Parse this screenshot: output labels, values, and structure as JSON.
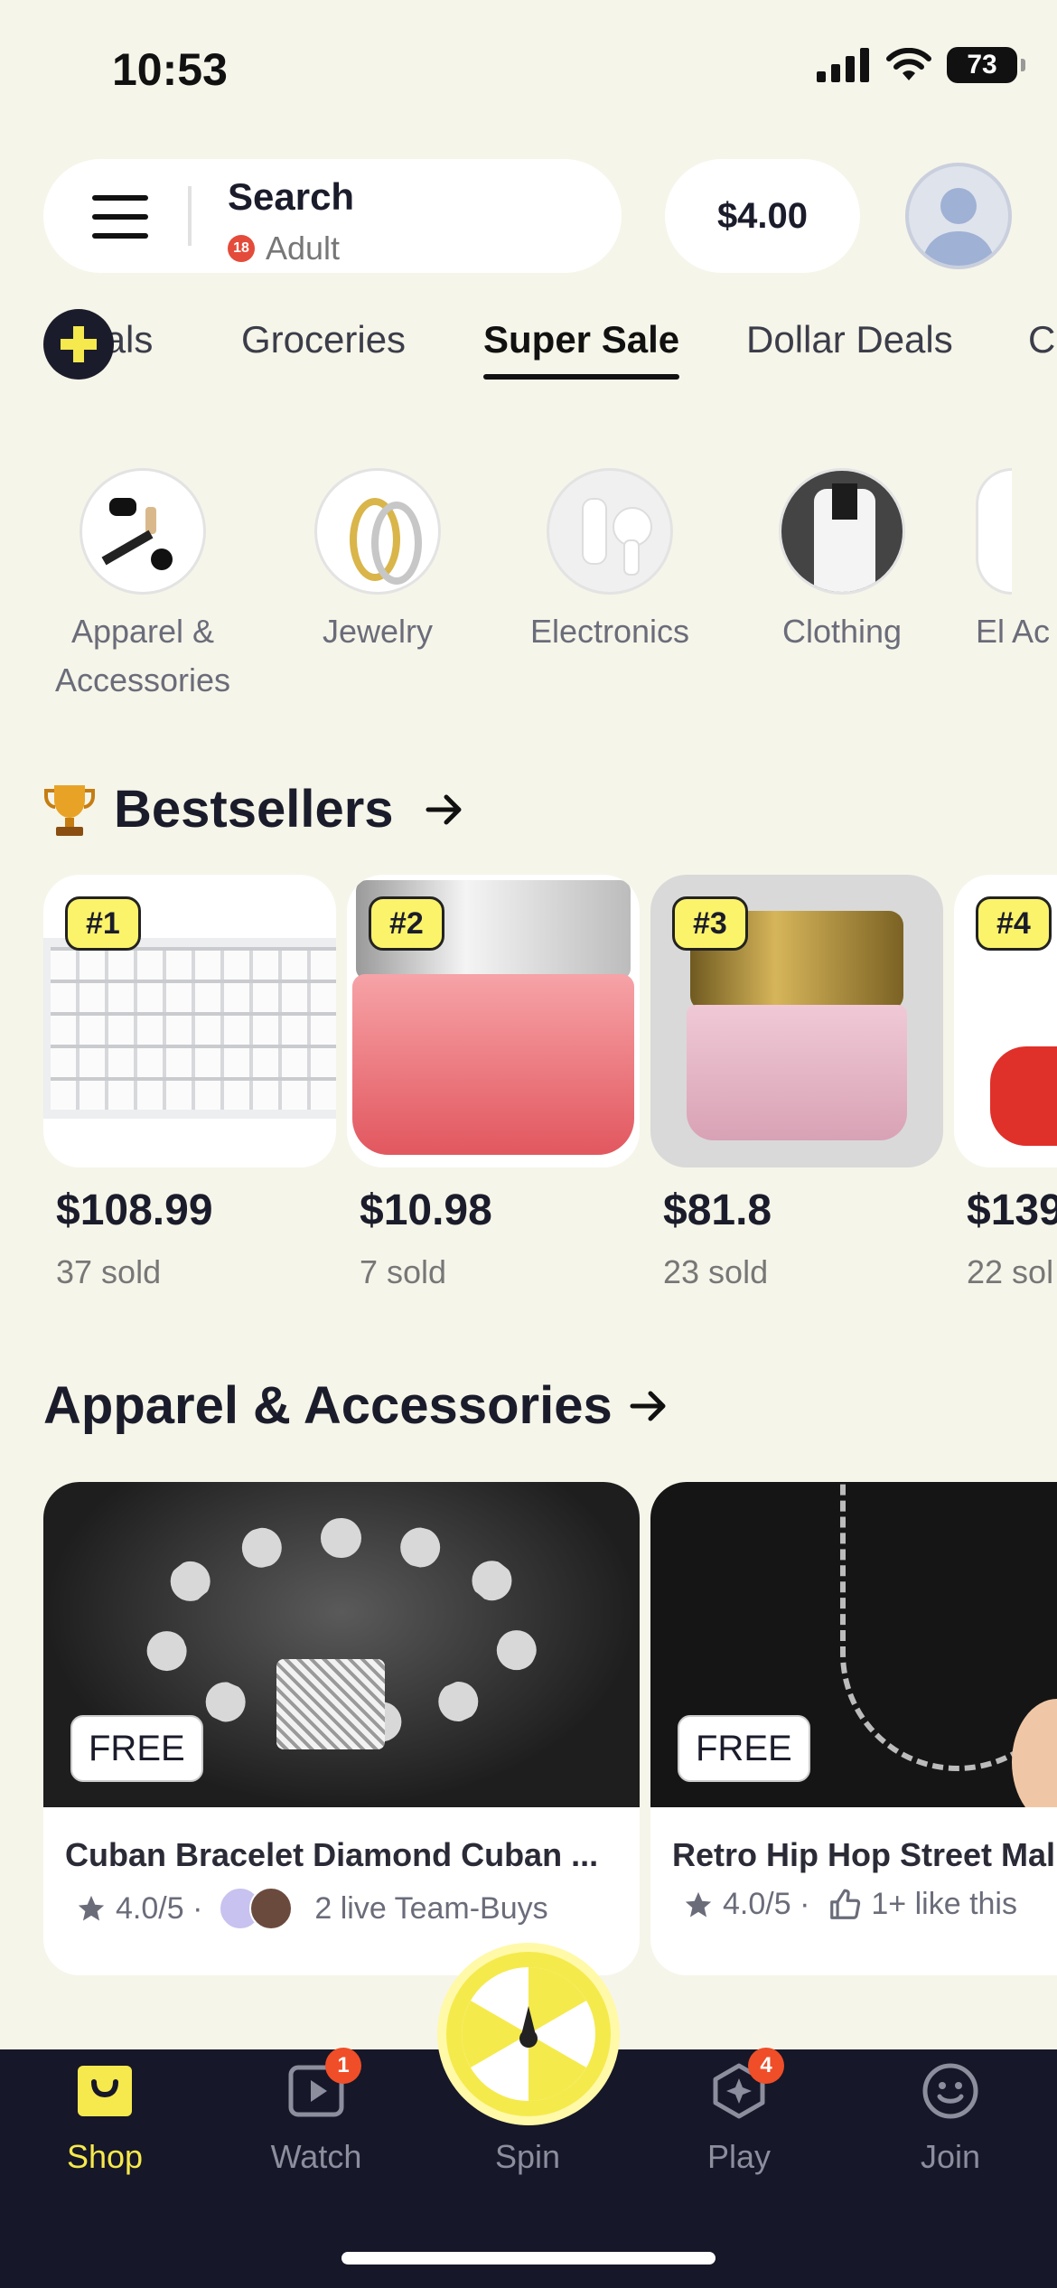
{
  "status_bar": {
    "time": "10:53",
    "battery": "73"
  },
  "header": {
    "search_title": "Search",
    "search_subtitle": "Adult",
    "age_badge": "18",
    "balance": "$4.00"
  },
  "tabs": [
    {
      "label": "Deals"
    },
    {
      "label": "Groceries"
    },
    {
      "label": "Super Sale",
      "active": true
    },
    {
      "label": "Dollar Deals"
    },
    {
      "label": "C"
    }
  ],
  "categories": [
    {
      "label": "Apparel & Accessories"
    },
    {
      "label": "Jewelry"
    },
    {
      "label": "Electronics"
    },
    {
      "label": "Clothing"
    },
    {
      "label": "El Ac"
    }
  ],
  "bestsellers": {
    "title": "Bestsellers",
    "items": [
      {
        "rank": "#1",
        "price": "$108.99",
        "sold": "37 sold"
      },
      {
        "rank": "#2",
        "price": "$10.98",
        "sold": "7 sold"
      },
      {
        "rank": "#3",
        "price": "$81.8",
        "sold": "23 sold"
      },
      {
        "rank": "#4",
        "price": "$139",
        "sold": "22 sol"
      }
    ]
  },
  "apparel": {
    "title": "Apparel & Accessories",
    "items": [
      {
        "badge": "FREE",
        "title": "Cuban Bracelet Diamond Cuban ...",
        "rating": "4.0/5 ·",
        "social": "2 live Team-Buys"
      },
      {
        "badge": "FREE",
        "title": "Retro Hip Hop Street Mal",
        "rating": "4.0/5 ·",
        "social": "1+ like this"
      }
    ]
  },
  "tabbar": {
    "shop": "Shop",
    "watch": "Watch",
    "watch_badge": "1",
    "spin": "Spin",
    "play": "Play",
    "play_badge": "4",
    "join": "Join"
  },
  "colors": {
    "accent": "#f5e94d",
    "background": "#f6f5e9",
    "tabbar": "#161728",
    "badge": "#ef4e28"
  }
}
